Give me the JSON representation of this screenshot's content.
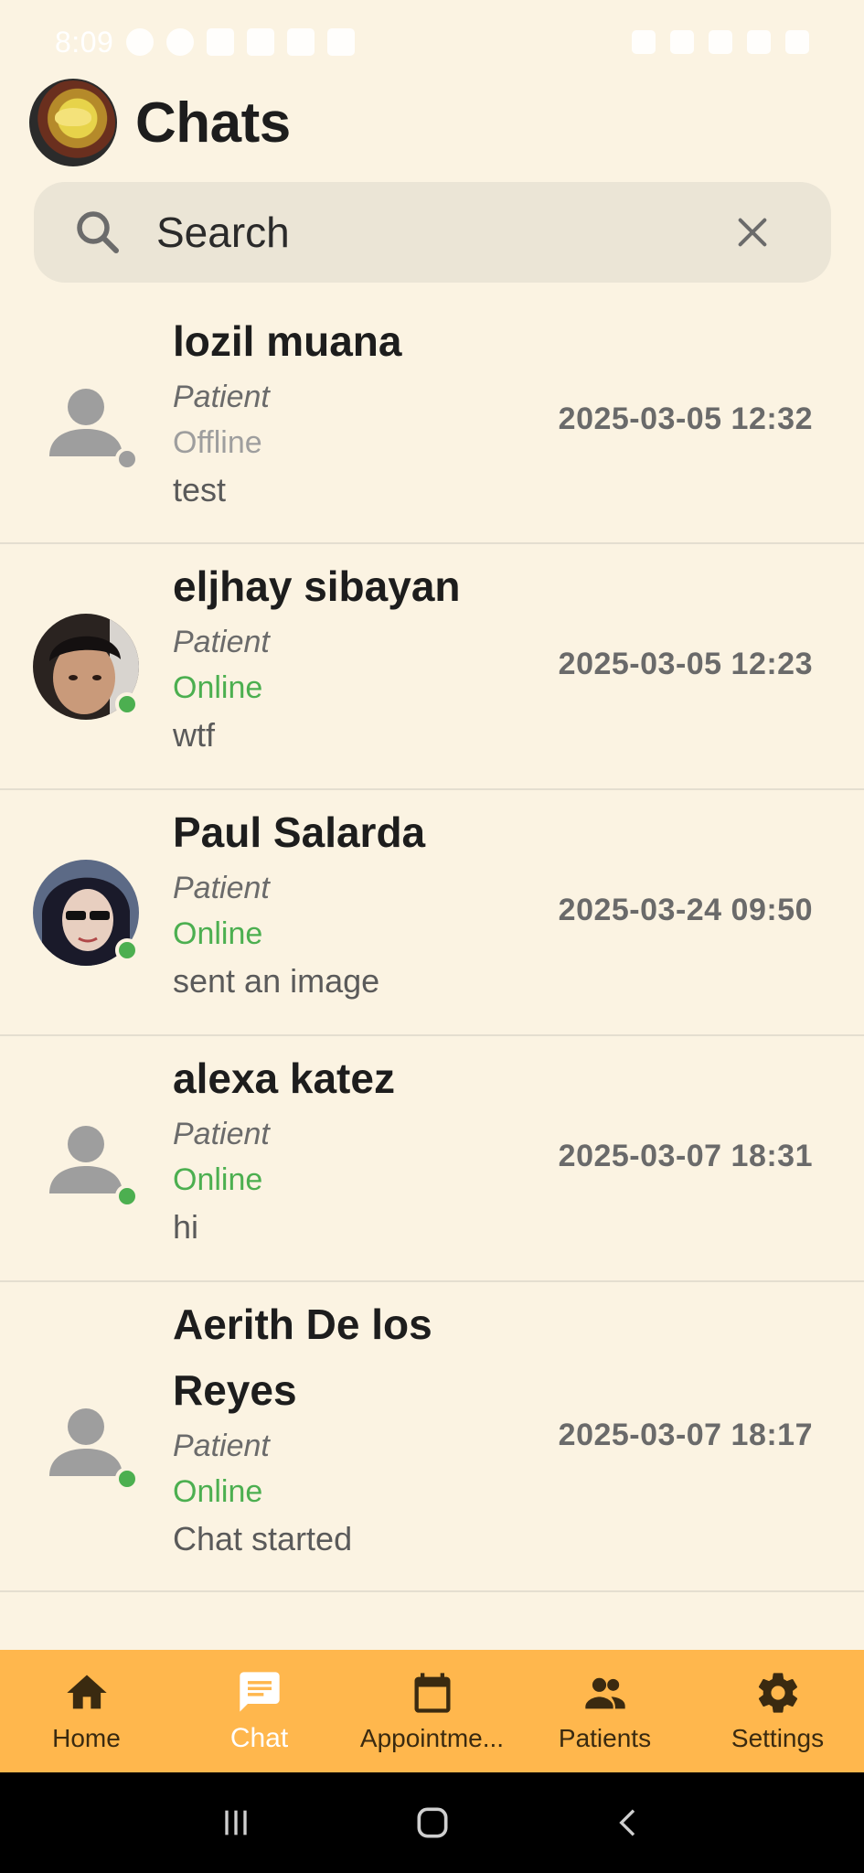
{
  "status_bar": {
    "time": "8:09"
  },
  "header": {
    "title": "Chats"
  },
  "search": {
    "placeholder": "Search"
  },
  "chats": [
    {
      "name": "lozil muana",
      "role": "Patient",
      "status": "Offline",
      "last_message": "test",
      "timestamp": "2025-03-05 12:32",
      "avatar": "default",
      "presence_color": "#9E9E9E",
      "status_color": "#9E9E9E"
    },
    {
      "name": "eljhay sibayan",
      "role": "Patient",
      "status": "Online",
      "last_message": "wtf",
      "timestamp": "2025-03-05 12:23",
      "avatar": "photo",
      "presence_color": "#4CAF50",
      "status_color": "#4CAF50"
    },
    {
      "name": "Paul Salarda",
      "role": "Patient",
      "status": "Online",
      "last_message": "sent an image",
      "timestamp": "2025-03-24 09:50",
      "avatar": "photo",
      "presence_color": "#4CAF50",
      "status_color": "#4CAF50"
    },
    {
      "name": "alexa katez",
      "role": "Patient",
      "status": "Online",
      "last_message": "hi",
      "timestamp": "2025-03-07 18:31",
      "avatar": "default",
      "presence_color": "#4CAF50",
      "status_color": "#4CAF50"
    },
    {
      "name_line1": "Aerith De los",
      "name_line2": "Reyes",
      "role": "Patient",
      "status": "Online",
      "last_message": "Chat started",
      "timestamp": "2025-03-07 18:17",
      "avatar": "default",
      "presence_color": "#4CAF50",
      "status_color": "#4CAF50"
    }
  ],
  "bottom_nav": [
    {
      "label": "Home",
      "icon": "home-icon",
      "active": false
    },
    {
      "label": "Chat",
      "icon": "chat-icon",
      "active": true
    },
    {
      "label": "Appointme...",
      "icon": "calendar-icon",
      "active": false
    },
    {
      "label": "Patients",
      "icon": "people-icon",
      "active": false
    },
    {
      "label": "Settings",
      "icon": "gear-icon",
      "active": false
    }
  ],
  "colors": {
    "background": "#FBF3E2",
    "nav_background": "#FFB74D",
    "online": "#4CAF50",
    "offline": "#9E9E9E",
    "search_background": "#EBE5D6"
  }
}
